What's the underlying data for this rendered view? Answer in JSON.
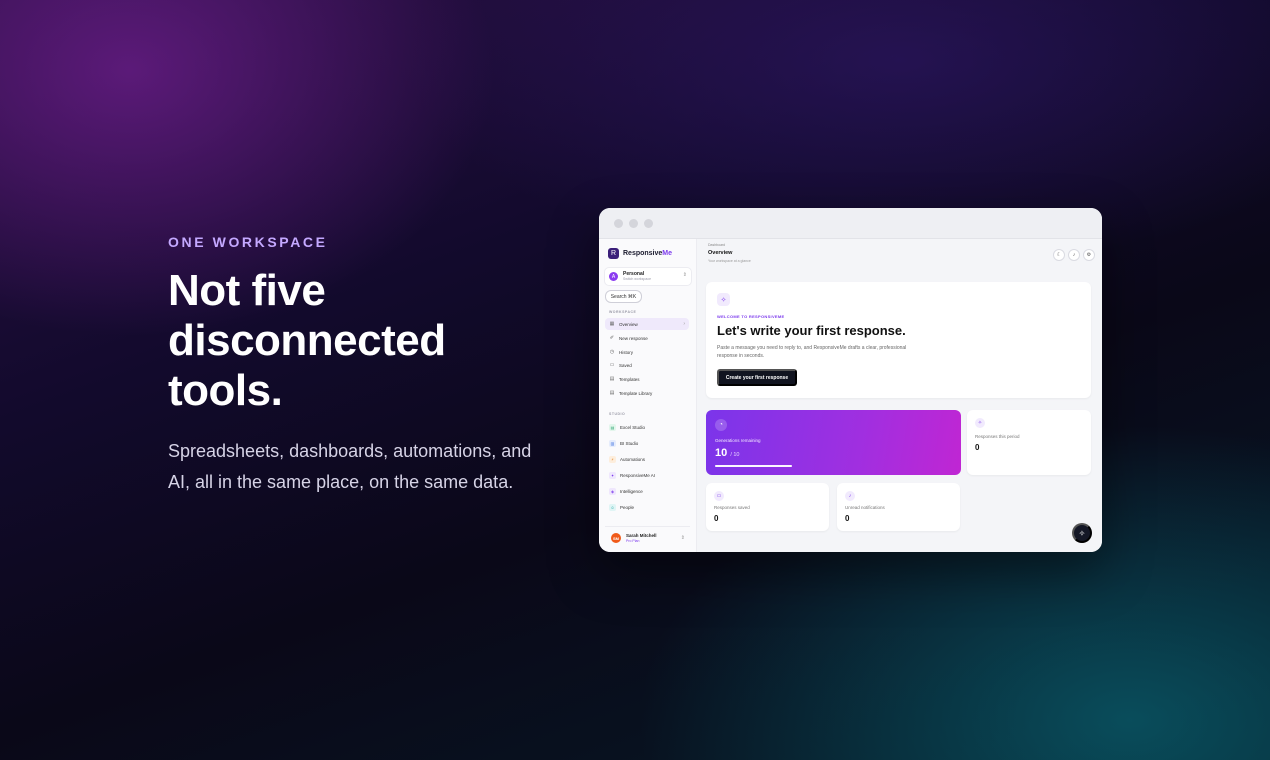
{
  "hero": {
    "eyebrow": "ONE WORKSPACE",
    "headline": "Not five\ndisconnected\ntools.",
    "subcopy": "Spreadsheets, dashboards, automations, and AI, all in the same place, on the same data."
  },
  "app": {
    "brand": {
      "name_main": "Responsive",
      "name_accent": "Me",
      "logo_icon": "R"
    },
    "workspace": {
      "avatar": "A",
      "name": "Personal",
      "subtitle": "Switch workspace"
    },
    "search": {
      "label": "Search ⌘K"
    },
    "sections": {
      "workspace": "WORKSPACE",
      "studio": "STUDIO"
    },
    "nav": [
      {
        "icon": "▦",
        "label": "Overview"
      },
      {
        "icon": "✐",
        "label": "New response"
      },
      {
        "icon": "◷",
        "label": "History"
      },
      {
        "icon": "▭",
        "label": "Saved"
      },
      {
        "icon": "▤",
        "label": "Templates"
      },
      {
        "icon": "▤",
        "label": "Template Library"
      }
    ],
    "studio_nav": [
      {
        "icon": "▤",
        "label": "Excel Studio",
        "color": "#22a06b",
        "bg": "#e3f6ec"
      },
      {
        "icon": "▥",
        "label": "BI Studio",
        "color": "#3b6fe0",
        "bg": "#e5ecfc"
      },
      {
        "icon": "⚡",
        "label": "Automations",
        "color": "#e07b1a",
        "bg": "#fdeedd"
      },
      {
        "icon": "✦",
        "label": "ResponsiveMe AI",
        "color": "#7c3aed",
        "bg": "#efe7fd"
      },
      {
        "icon": "◈",
        "label": "Intelligence",
        "color": "#7c3aed",
        "bg": "#efe7fd"
      },
      {
        "icon": "☺",
        "label": "People",
        "color": "#14a3a3",
        "bg": "#e0f5f5"
      }
    ],
    "user": {
      "initials": "SM",
      "name": "Sarah Mitchell",
      "plan": "Pro Plan"
    },
    "header": {
      "breadcrumb": "Dashboard",
      "title": "Overview",
      "subtitle": "Your workspace at a glance",
      "icons": [
        "moon-icon",
        "bell-icon",
        "gear-icon"
      ]
    },
    "welcome": {
      "icon": "✧",
      "eyebrow": "WELCOME TO RESPONSIVEME",
      "title": "Let's write your first response.",
      "description": "Paste a message you need to reply to, and ResponsiveMe drafts a clear, professional response in seconds.",
      "button": "Create your first response"
    },
    "stats": {
      "generations": {
        "icon": "◔",
        "label": "Generations remaining",
        "value": "10",
        "total": "/ 10",
        "progress": 1.0
      },
      "responses_period": {
        "icon": "✧",
        "label": "Responses this period",
        "value": "0"
      },
      "responses_saved": {
        "icon": "▭",
        "label": "Responses saved",
        "value": "0"
      },
      "unread": {
        "icon": "♪",
        "label": "Unread notifications",
        "value": "0"
      }
    },
    "fab": {
      "icon": "✧"
    },
    "colors": {
      "accent": "#7c3aed",
      "gradient_start": "#7b35ea",
      "gradient_end": "#c026d3"
    }
  }
}
